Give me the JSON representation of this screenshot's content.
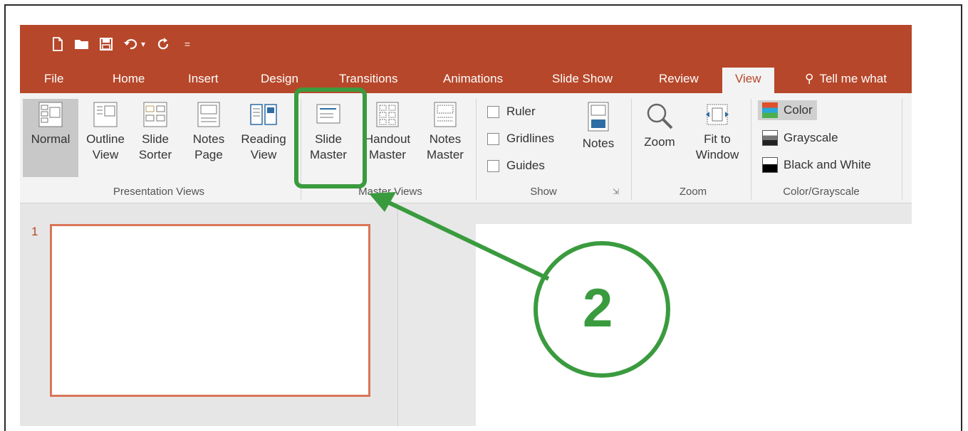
{
  "qat": {
    "icons": [
      "new-file-icon",
      "open-folder-icon",
      "save-icon",
      "undo-icon",
      "redo-icon",
      "customize-qat-icon"
    ],
    "undo_dropdown": "▾",
    "customize": "="
  },
  "tabs": [
    "File",
    "Home",
    "Insert",
    "Design",
    "Transitions",
    "Animations",
    "Slide Show",
    "Review",
    "View"
  ],
  "tell_me": "Tell me what",
  "ribbon": {
    "presentation_views": {
      "label": "Presentation Views",
      "buttons": [
        {
          "line1": "Normal",
          "line2": ""
        },
        {
          "line1": "Outline",
          "line2": "View"
        },
        {
          "line1": "Slide",
          "line2": "Sorter"
        },
        {
          "line1": "Notes",
          "line2": "Page"
        },
        {
          "line1": "Reading",
          "line2": "View"
        }
      ]
    },
    "master_views": {
      "label": "Master Views",
      "buttons": [
        {
          "line1": "Slide",
          "line2": "Master"
        },
        {
          "line1": "Handout",
          "line2": "Master"
        },
        {
          "line1": "Notes",
          "line2": "Master"
        }
      ]
    },
    "show": {
      "label": "Show",
      "checkboxes": [
        "Ruler",
        "Gridlines",
        "Guides"
      ],
      "notes_button": "Notes"
    },
    "zoom": {
      "label": "Zoom",
      "zoom_button": "Zoom",
      "fit_line1": "Fit to",
      "fit_line2": "Window"
    },
    "color_grayscale": {
      "label": "Color/Grayscale",
      "options": [
        "Color",
        "Grayscale",
        "Black and White"
      ]
    }
  },
  "slides": {
    "first_number": "1"
  },
  "annotation": {
    "number": "2",
    "color": "#3a9b3e"
  },
  "colors": {
    "accent": "#b7472a",
    "highlight": "#3a9b3e"
  }
}
